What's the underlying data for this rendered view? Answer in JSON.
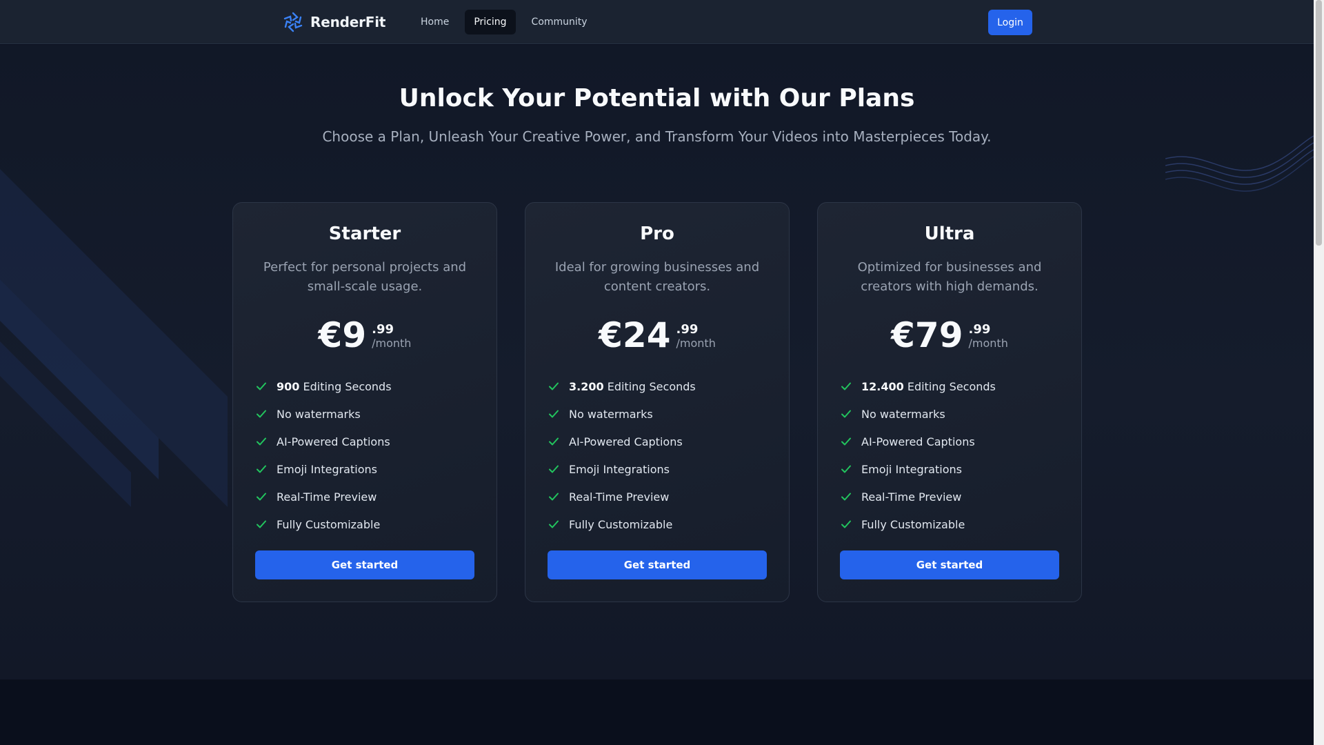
{
  "app": {
    "brand_name": "RenderFit",
    "accent_color": "#2563eb",
    "check_color": "#22c55e"
  },
  "nav": {
    "links": [
      {
        "label": "Home",
        "active": false
      },
      {
        "label": "Pricing",
        "active": true
      },
      {
        "label": "Community",
        "active": false
      }
    ],
    "login_label": "Login"
  },
  "hero": {
    "title": "Unlock Your Potential with Our Plans",
    "subtitle": "Choose a Plan, Unleash Your Creative Power, and Transform Your Videos into Masterpieces Today."
  },
  "plans": [
    {
      "name": "Starter",
      "description": "Perfect for personal projects and small-scale usage.",
      "price_main": "€9",
      "price_cents": ".99",
      "period": "/month",
      "seconds": "900",
      "seconds_label": "Editing Seconds",
      "features": [
        "No watermarks",
        "AI-Powered Captions",
        "Emoji Integrations",
        "Real-Time Preview",
        "Fully Customizable"
      ],
      "cta": "Get started"
    },
    {
      "name": "Pro",
      "description": "Ideal for growing businesses and content creators.",
      "price_main": "€24",
      "price_cents": ".99",
      "period": "/month",
      "seconds": "3.200",
      "seconds_label": "Editing Seconds",
      "features": [
        "No watermarks",
        "AI-Powered Captions",
        "Emoji Integrations",
        "Real-Time Preview",
        "Fully Customizable"
      ],
      "cta": "Get started"
    },
    {
      "name": "Ultra",
      "description": "Optimized for businesses and creators with high demands.",
      "price_main": "€79",
      "price_cents": ".99",
      "period": "/month",
      "seconds": "12.400",
      "seconds_label": "Editing Seconds",
      "features": [
        "No watermarks",
        "AI-Powered Captions",
        "Emoji Integrations",
        "Real-Time Preview",
        "Fully Customizable"
      ],
      "cta": "Get started"
    }
  ],
  "icons": {
    "logo": "aperture-logo-icon",
    "check": "check-icon"
  }
}
